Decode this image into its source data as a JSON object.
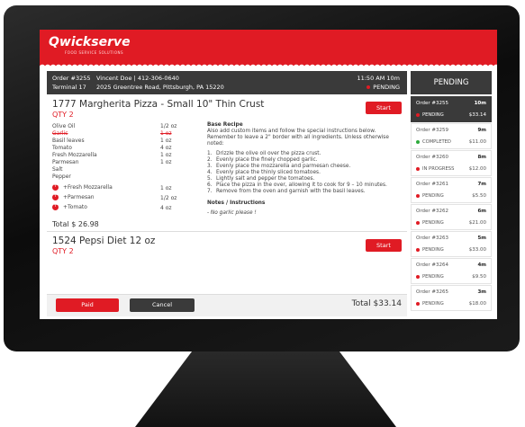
{
  "app": {
    "brand": "Qwickserve",
    "tagline": "FOOD SERVICE SOLUTIONS"
  },
  "order": {
    "number": "Order #3255",
    "terminal": "Terminal 17",
    "customer": "Vincent Doe  |  412-306-0640",
    "address": "2025 Greentree Road, Pittsburgh, PA  15220",
    "time": "11:50 AM  10m",
    "status": "PENDING"
  },
  "item1": {
    "title": "1777 Margherita Pizza  - Small 10\" Thin Crust",
    "qty": "QTY 2",
    "start_label": "Start",
    "ingredients": [
      {
        "name": "Olive Oil",
        "qty": "1/2 oz",
        "removed": false
      },
      {
        "name": "Garlic",
        "qty": "1 oz",
        "removed": true
      },
      {
        "name": "Basil leaves",
        "qty": "1 oz",
        "removed": false
      },
      {
        "name": "Tomato",
        "qty": "4 oz",
        "removed": false
      },
      {
        "name": "Fresh Mozzarella",
        "qty": "1 oz",
        "removed": false
      },
      {
        "name": "Parmesan",
        "qty": "1 oz",
        "removed": false
      },
      {
        "name": "Salt",
        "qty": "",
        "removed": false
      },
      {
        "name": "Pepper",
        "qty": "",
        "removed": false
      }
    ],
    "addons": [
      {
        "name": "+Fresh Mozzarella",
        "qty": "1 oz"
      },
      {
        "name": "+Parmesan",
        "qty": "1/2 oz"
      },
      {
        "name": "+Tomato",
        "qty": "4 oz"
      }
    ],
    "total": "Total $ 26.98",
    "recipe_heading": "Base Recipe",
    "recipe_intro": "Also add custom items and follow the special instructions below. Remember to leave a 2\" border with all ingredients. Unless otherwise noted:",
    "steps": [
      {
        "n": "1.",
        "text": "Drizzle the olive oil over the pizza crust."
      },
      {
        "n": "2.",
        "text": "Evenly place the finely chopped garlic."
      },
      {
        "n": "3.",
        "text": "Evenly place the  mozzarella and parmesan cheese."
      },
      {
        "n": "4.",
        "text": "Evenly place the thinly sliced tomatoes."
      },
      {
        "n": "5.",
        "text": "Lightly salt and pepper the tomatoes."
      },
      {
        "n": "6.",
        "text": "Place the pizza in the over, allowing it to cook for 9 – 10 minutes."
      },
      {
        "n": "7.",
        "text": "Remove from the oven and garnish with the basil leaves."
      }
    ],
    "notes_heading": "Notes / Instructions",
    "notes": "- No garlic please !"
  },
  "item2": {
    "title": "1524 Pepsi Diet 12 oz",
    "qty": "QTY 2",
    "start_label": "Start"
  },
  "actions": {
    "paid_label": "Paid",
    "cancel_label": "Cancel",
    "total": "Total  $33.14"
  },
  "queue": {
    "header": "PENDING",
    "orders": [
      {
        "number": "Order #3255",
        "age": "10m",
        "status": "PENDING",
        "amount": "$33.14",
        "status_color": "#e01b24"
      },
      {
        "number": "Order #3259",
        "age": "9m",
        "status": "COMPLETED",
        "amount": "$11.00",
        "status_color": "#2eaa3c"
      },
      {
        "number": "Order #3260",
        "age": "8m",
        "status": "IN PROGRESS",
        "amount": "$12.00",
        "status_color": "#e01b24"
      },
      {
        "number": "Order #3261",
        "age": "7m",
        "status": "PENDING",
        "amount": "$5.50",
        "status_color": "#e01b24"
      },
      {
        "number": "Order #3262",
        "age": "6m",
        "status": "PENDING",
        "amount": "$21.00",
        "status_color": "#e01b24"
      },
      {
        "number": "Order #3263",
        "age": "5m",
        "status": "PENDING",
        "amount": "$33.00",
        "status_color": "#e01b24"
      },
      {
        "number": "Order #3264",
        "age": "4m",
        "status": "PENDING",
        "amount": "$9.50",
        "status_color": "#e01b24"
      },
      {
        "number": "Order #3265",
        "age": "3m",
        "status": "PENDING",
        "amount": "$18.00",
        "status_color": "#e01b24"
      }
    ]
  }
}
